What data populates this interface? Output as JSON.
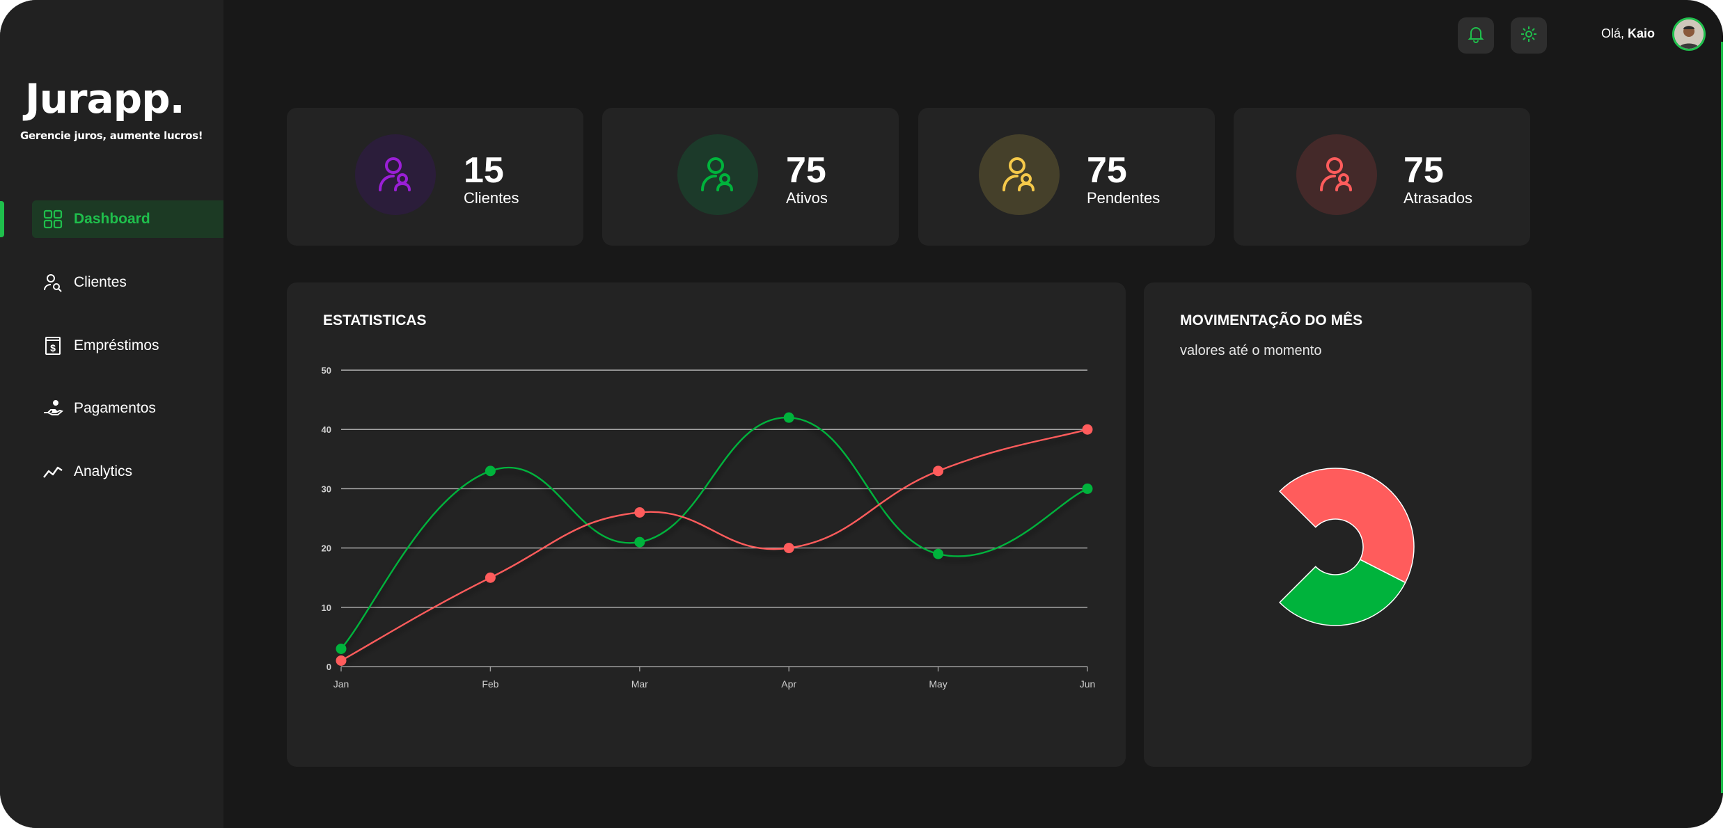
{
  "brand": {
    "name": "Jurapp.",
    "tagline": "Gerencie juros, aumente lucros!"
  },
  "sidebar": {
    "items": [
      {
        "label": "Dashboard",
        "icon": "grid-icon",
        "active": true
      },
      {
        "label": "Clientes",
        "icon": "user-search-icon"
      },
      {
        "label": "Empréstimos",
        "icon": "dollar-document-icon"
      },
      {
        "label": "Pagamentos",
        "icon": "hand-coin-icon"
      },
      {
        "label": "Analytics",
        "icon": "trend-line-icon"
      }
    ]
  },
  "header": {
    "greeting": "Olá,",
    "user_name": "Kaio"
  },
  "colors": {
    "accent": "#1fbf4c",
    "red": "#ff5c5c",
    "purple": "#9a1fd6",
    "yellow": "#f5c94a"
  },
  "stats": [
    {
      "value": "15",
      "label": "Clientes",
      "icon": "user-purple-icon"
    },
    {
      "value": "75",
      "label": "Ativos",
      "icon": "user-green-icon"
    },
    {
      "value": "75",
      "label": "Pendentes",
      "icon": "user-yellow-icon"
    },
    {
      "value": "75",
      "label": "Atrasados",
      "icon": "user-red-icon"
    }
  ],
  "stats_panel": {
    "title": "ESTATISTICAS"
  },
  "month_panel": {
    "title": "MOVIMENTAÇÃO DO MÊS",
    "subtitle": "valores até o momento"
  },
  "chart_data": [
    {
      "type": "line",
      "x": [
        "Jan",
        "Feb",
        "Mar",
        "Apr",
        "May",
        "Jun"
      ],
      "ylim": [
        0,
        50
      ],
      "yticks": [
        0,
        10,
        20,
        30,
        40,
        50
      ],
      "grid": true,
      "series": [
        {
          "color": "#00b33c",
          "values": [
            3,
            33,
            21,
            42,
            19,
            30
          ]
        },
        {
          "color": "#ff5c5c",
          "values": [
            1,
            15,
            26,
            20,
            33,
            40
          ]
        }
      ]
    },
    {
      "type": "pie",
      "slices": [
        {
          "color": "#ff5c5c",
          "value": 60
        },
        {
          "color": "#00b33c",
          "value": 40
        }
      ],
      "start_angle_deg": 225,
      "sweep_deg": 270
    }
  ]
}
